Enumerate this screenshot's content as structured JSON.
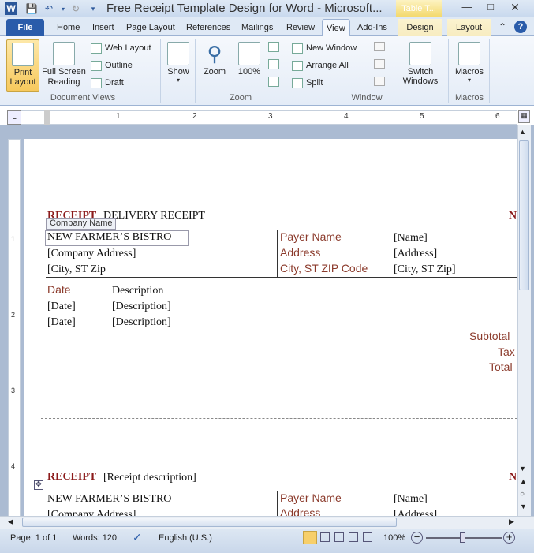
{
  "titlebar": {
    "title": "Free Receipt Template Design for Word  -  Microsoft...",
    "context_tab": "Table T..."
  },
  "tabs": [
    "File",
    "Home",
    "Insert",
    "Page Layout",
    "References",
    "Mailings",
    "Review",
    "View",
    "Add-Ins",
    "Design",
    "Layout"
  ],
  "ribbon": {
    "document_views": {
      "label": "Document Views",
      "print_layout": "Print Layout",
      "full_screen_reading": "Full Screen Reading",
      "web_layout": "Web Layout",
      "outline": "Outline",
      "draft": "Draft"
    },
    "show": {
      "label": "Show"
    },
    "zoom": {
      "label": "Zoom",
      "zoom_btn": "Zoom",
      "hundred": "100%"
    },
    "window": {
      "label": "Window",
      "new_window": "New Window",
      "arrange_all": "Arrange All",
      "split": "Split",
      "switch_windows": "Switch Windows"
    },
    "macros": {
      "label": "Macros",
      "macros_btn": "Macros"
    }
  },
  "ruler": {
    "numbers": [
      "1",
      "2",
      "3",
      "4",
      "5",
      "6"
    ],
    "vnumbers": [
      "1",
      "2",
      "3",
      "4"
    ]
  },
  "doc": {
    "receipt1": {
      "title": "RECEIPT",
      "description": "DELIVERY RECEIPT",
      "right_marker": "N",
      "tag": "Company Name",
      "company": "NEW FARMER’S BISTRO",
      "address": "[Company Address]",
      "city": "[City, ST  Zip",
      "payer_label": "Payer Name",
      "address_label": "Address",
      "cityzip_label": "City, ST ZIP Code",
      "payer_value": "[Name]",
      "address_value": "[Address]",
      "city_value": "[City, ST  Zip]",
      "date_header": "Date",
      "desc_header": "Description",
      "rows": [
        [
          "[Date]",
          "[Description]"
        ],
        [
          "[Date]",
          "[Description]"
        ]
      ],
      "subtotal": "Subtotal",
      "tax": "Tax",
      "total": "Total"
    },
    "receipt2": {
      "title": "RECEIPT",
      "description": "[Receipt description]",
      "right_marker": "N",
      "company": "NEW FARMER’S BISTRO",
      "address": "[Company Address]",
      "payer_label": "Payer Name",
      "address_label": "Address",
      "payer_value": "[Name]",
      "address_value": "[Address]"
    }
  },
  "status": {
    "page": "Page: 1 of 1",
    "words": "Words: 120",
    "language": "English (U.S.)",
    "zoom": "100%"
  },
  "colors": {
    "accent": "#2a5caa",
    "label_red": "#8b3a2b",
    "title_red": "#8b1a1a"
  }
}
